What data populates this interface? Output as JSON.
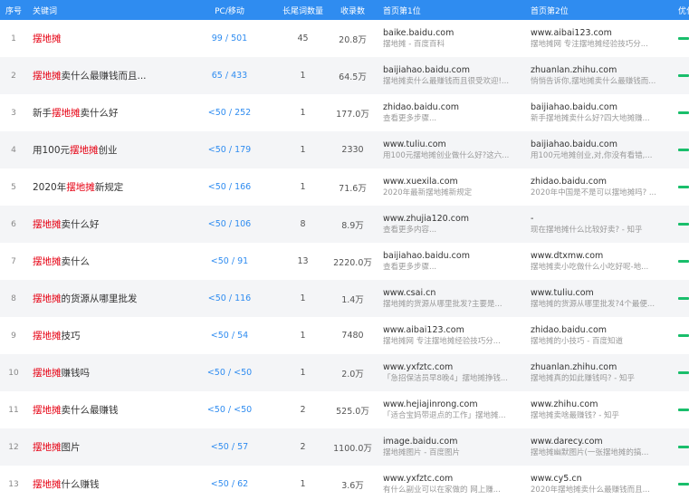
{
  "header": {
    "index": "序号",
    "keyword": "关键词",
    "pc_mobile": "PC/移动",
    "long_tail": "长尾词数量",
    "indexed": "收录数",
    "rank1": "首页第1位",
    "rank2": "首页第2位",
    "optimize": "优化"
  },
  "colors": {
    "header_bg": "#2f8cf0",
    "highlight": "#e60012",
    "pc_link": "#2f8cf0",
    "bar": "#19be6b"
  },
  "rows": [
    {
      "index": "1",
      "kw_pre": "",
      "kw_hl": "摆地摊",
      "kw_post": "",
      "pc": "99 / 501",
      "tail": "45",
      "count": "20.8万",
      "r1_url": "baike.baidu.com",
      "r1_desc": "摆地摊 - 百度百科",
      "r2_url": "www.aibai123.com",
      "r2_desc": "摆地摊网 专注摆地摊经验技巧分..."
    },
    {
      "index": "2",
      "kw_pre": "",
      "kw_hl": "摆地摊",
      "kw_post": "卖什么最赚钱而且...",
      "pc": "65 / 433",
      "tail": "1",
      "count": "64.5万",
      "r1_url": "baijiahao.baidu.com",
      "r1_desc": "摆地摊卖什么最赚钱而且很受欢迎!...",
      "r2_url": "zhuanlan.zhihu.com",
      "r2_desc": "悄悄告诉你,摆地摊卖什么最赚钱而..."
    },
    {
      "index": "3",
      "kw_pre": "新手",
      "kw_hl": "摆地摊",
      "kw_post": "卖什么好",
      "pc": "<50 / 252",
      "tail": "1",
      "count": "177.0万",
      "r1_url": "zhidao.baidu.com",
      "r1_desc": "查看更多步骤...",
      "r2_url": "baijiahao.baidu.com",
      "r2_desc": "新手摆地摊卖什么好?四大地摊赚..."
    },
    {
      "index": "4",
      "kw_pre": "用100元",
      "kw_hl": "摆地摊",
      "kw_post": "创业",
      "pc": "<50 / 179",
      "tail": "1",
      "count": "2330",
      "r1_url": "www.tuliu.com",
      "r1_desc": "用100元摆地摊创业做什么好?这六...",
      "r2_url": "baijiahao.baidu.com",
      "r2_desc": "用100元地摊创业,对,你没有看错,..."
    },
    {
      "index": "5",
      "kw_pre": "2020年",
      "kw_hl": "摆地摊",
      "kw_post": "新规定",
      "pc": "<50 / 166",
      "tail": "1",
      "count": "71.6万",
      "r1_url": "www.xuexila.com",
      "r1_desc": "2020年最新摆地摊新规定",
      "r2_url": "zhidao.baidu.com",
      "r2_desc": "2020年中国是不是可以摆地摊吗? ..."
    },
    {
      "index": "6",
      "kw_pre": "",
      "kw_hl": "摆地摊",
      "kw_post": "卖什么好",
      "pc": "<50 / 106",
      "tail": "8",
      "count": "8.9万",
      "r1_url": "www.zhujia120.com",
      "r1_desc": "查看更多内容...",
      "r2_url": "-",
      "r2_desc": "现在摆地摊什么比较好卖? - 知乎"
    },
    {
      "index": "7",
      "kw_pre": "",
      "kw_hl": "摆地摊",
      "kw_post": "卖什么",
      "pc": "<50 / 91",
      "tail": "13",
      "count": "2220.0万",
      "r1_url": "baijiahao.baidu.com",
      "r1_desc": "查看更多步骤...",
      "r2_url": "www.dtxmw.com",
      "r2_desc": "摆地摊卖小吃做什么小吃好呢-地..."
    },
    {
      "index": "8",
      "kw_pre": "",
      "kw_hl": "摆地摊",
      "kw_post": "的货源从哪里批发",
      "pc": "<50 / 116",
      "tail": "1",
      "count": "1.4万",
      "r1_url": "www.csai.cn",
      "r1_desc": "摆地摊的货源从哪里批发?主要是...",
      "r2_url": "www.tuliu.com",
      "r2_desc": "摆地摊的货源从哪里批发?4个最便..."
    },
    {
      "index": "9",
      "kw_pre": "",
      "kw_hl": "摆地摊",
      "kw_post": "技巧",
      "pc": "<50 / 54",
      "tail": "1",
      "count": "7480",
      "r1_url": "www.aibai123.com",
      "r1_desc": "摆地摊网 专注摆地摊经验技巧分...",
      "r2_url": "zhidao.baidu.com",
      "r2_desc": "摆地摊的小技巧 - 百度知道"
    },
    {
      "index": "10",
      "kw_pre": "",
      "kw_hl": "摆地摊",
      "kw_post": "赚钱吗",
      "pc": "<50 / <50",
      "tail": "1",
      "count": "2.0万",
      "r1_url": "www.yxfztc.com",
      "r1_desc": "「急招保洁员早8晚4」摆地摊挣钱...",
      "r2_url": "zhuanlan.zhihu.com",
      "r2_desc": "摆地摊真的如此赚钱吗? - 知乎"
    },
    {
      "index": "11",
      "kw_pre": "",
      "kw_hl": "摆地摊",
      "kw_post": "卖什么最赚钱",
      "pc": "<50 / <50",
      "tail": "2",
      "count": "525.0万",
      "r1_url": "www.hejiajinrong.com",
      "r1_desc": "「适合宝妈带退点的工作」摆地摊...",
      "r2_url": "www.zhihu.com",
      "r2_desc": "摆地摊卖啥最赚钱? - 知乎"
    },
    {
      "index": "12",
      "kw_pre": "",
      "kw_hl": "摆地摊",
      "kw_post": "图片",
      "pc": "<50 / 57",
      "tail": "2",
      "count": "1100.0万",
      "r1_url": "image.baidu.com",
      "r1_desc": "摆地摊图片 - 百度图片",
      "r2_url": "www.darecy.com",
      "r2_desc": "摆地摊幽默图片(一张摆地摊的搞..."
    },
    {
      "index": "13",
      "kw_pre": "",
      "kw_hl": "摆地摊",
      "kw_post": "什么赚钱",
      "pc": "<50 / 62",
      "tail": "1",
      "count": "3.6万",
      "r1_url": "www.yxfztc.com",
      "r1_desc": "有什么副业可以在家做的 网上赚...",
      "r2_url": "www.cy5.cn",
      "r2_desc": "2020年摆地摊卖什么最赚钱而且..."
    }
  ]
}
